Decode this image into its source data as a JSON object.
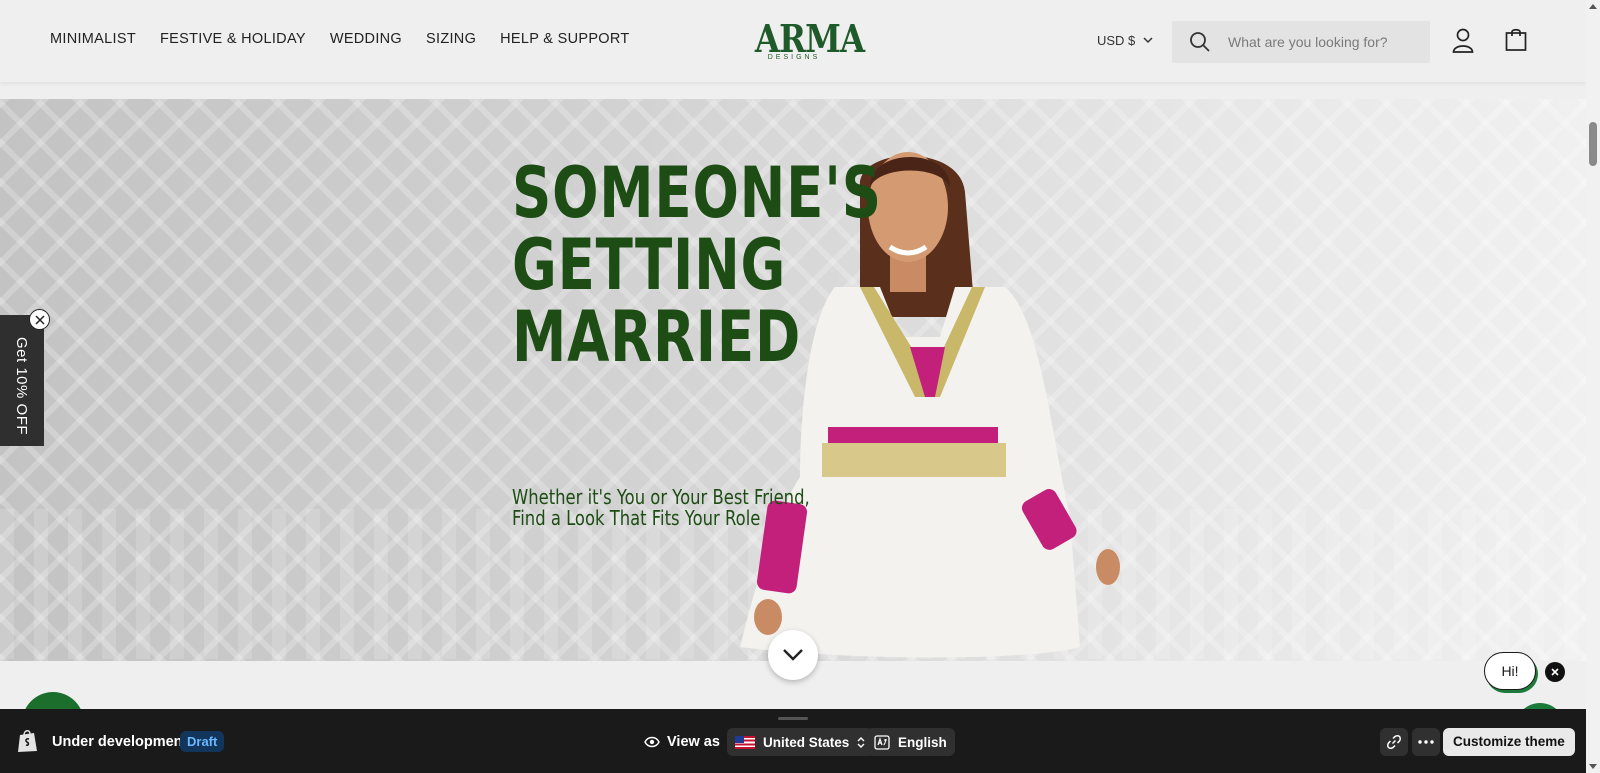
{
  "header": {
    "nav": [
      "MINIMALIST",
      "FESTIVE & HOLIDAY",
      "WEDDING",
      "SIZING",
      "HELP & SUPPORT"
    ],
    "logo_main": "ARMA",
    "logo_sub": "DESIGNS",
    "currency": "USD $",
    "search_placeholder": "What are you looking for?"
  },
  "hero": {
    "headline": [
      "SOMEONE'S",
      "GETTING",
      "MARRIED"
    ],
    "subline": [
      "Whether it's You or Your Best Friend,",
      "Find a Look That Fits Your Role"
    ]
  },
  "popup": {
    "discount_tab": "Get 10% OFF"
  },
  "chat": {
    "greeting": "Hi!"
  },
  "preview_bar": {
    "status": "Under development",
    "badge": "Draft",
    "view_as": "View as",
    "country": "United States",
    "language": "English",
    "customize": "Customize theme"
  },
  "colors": {
    "brand_green": "#1f5a2a",
    "headline_green": "#1d4d14",
    "draft_badge_bg": "#12365b",
    "draft_badge_text": "#6ab8ff"
  }
}
